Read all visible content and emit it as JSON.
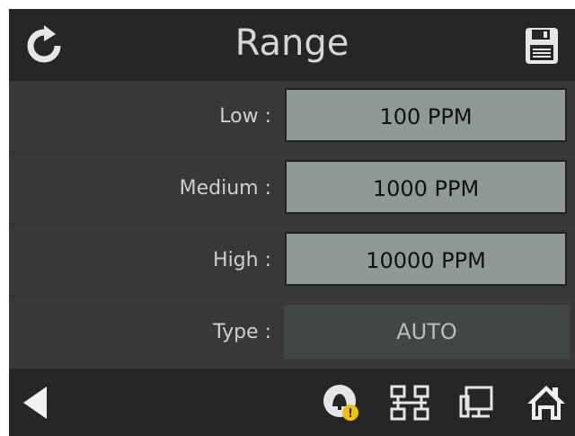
{
  "header": {
    "title": "Range",
    "refresh_icon": "refresh-icon",
    "save_icon": "save-icon"
  },
  "rows": [
    {
      "label": "Low :",
      "value": "100 PPM"
    },
    {
      "label": "Medium :",
      "value": "1000 PPM"
    },
    {
      "label": "High :",
      "value": "10000 PPM"
    },
    {
      "label": "Type :",
      "value": "AUTO"
    }
  ],
  "footer": {
    "back_icon": "back-arrow-icon",
    "alarm_icon": "alarm-bell-icon",
    "alarm_badge": "!",
    "network_icon": "network-icon",
    "computer_icon": "computer-icon",
    "home_icon": "home-icon"
  },
  "colors": {
    "header": "#262626",
    "background": "#3b3b3b",
    "field": "#909a95",
    "field_readonly": "#414744",
    "badge": "#f2c200"
  }
}
